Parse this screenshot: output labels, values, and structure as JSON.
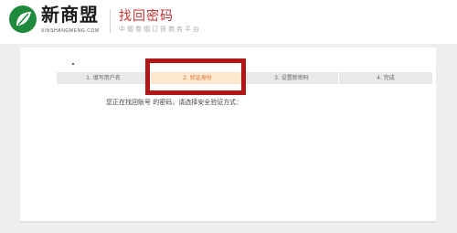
{
  "header": {
    "logo_text": "新商盟",
    "logo_sub": "XINSHANGMENG.COM",
    "title": "找回密码",
    "subtitle": "中烟卷烟订货商务平台"
  },
  "steps": [
    {
      "label": "1. 填写用户名",
      "active": false
    },
    {
      "label": "2. 验证身份",
      "active": true
    },
    {
      "label": "3. 设置新密码",
      "active": false
    },
    {
      "label": "4. 完成",
      "active": false
    }
  ],
  "prompt": "您正在找回账号   的密码，请选择安全验证方式：",
  "colors": {
    "brand_red": "#c8322e",
    "highlight": "#ae1918",
    "active_step_bg": "#fde7cf",
    "active_step_text": "#e0712e",
    "logo_green": "#1f8a3b"
  }
}
